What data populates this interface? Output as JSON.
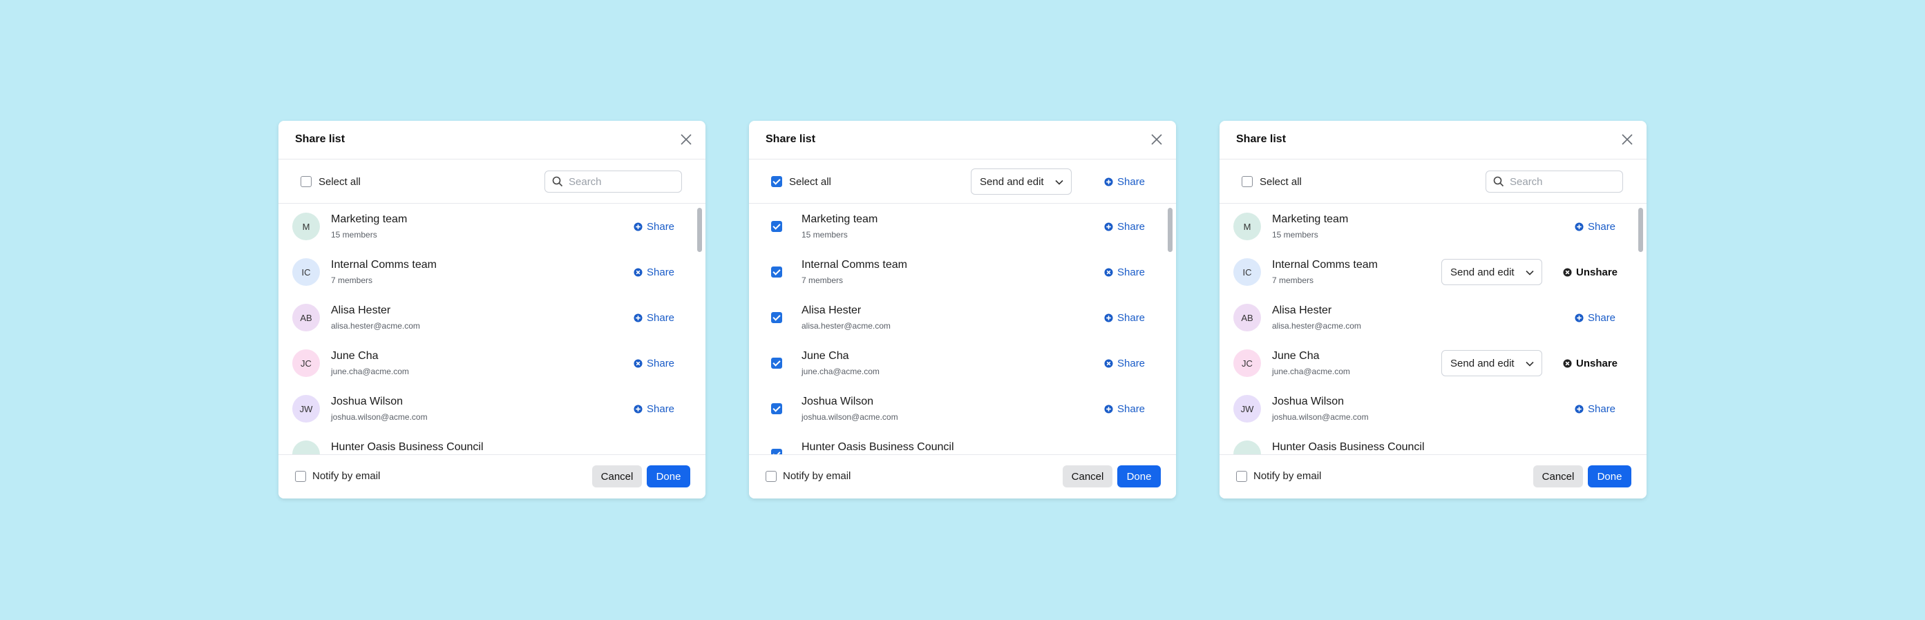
{
  "colors": {
    "background": "#bdebf6",
    "primary": "#1466ec",
    "share_link": "#1a5cc8",
    "avatar_m": "#d7ece6",
    "avatar_ic": "#dce9fb",
    "avatar_ab": "#eedcf4",
    "avatar_jc": "#fbdcef",
    "avatar_jw": "#e7defa"
  },
  "icons": {
    "close": "close-icon",
    "search": "search-icon",
    "share_plus": "plus-circle-icon",
    "share_x": "x-circle-icon",
    "chevron": "chevron-down-icon"
  },
  "common": {
    "title": "Share list",
    "select_all": "Select all",
    "search_placeholder": "Search",
    "share": "Share",
    "unshare": "Unshare",
    "permission": "Send and edit",
    "notify": "Notify by email",
    "cancel": "Cancel",
    "done": "Done",
    "partial_row": "Hunter Oasis Business Council"
  },
  "items": [
    {
      "initials": "M",
      "name": "Marketing team",
      "detail": "15 members"
    },
    {
      "initials": "IC",
      "name": "Internal Comms team",
      "detail": "7 members"
    },
    {
      "initials": "AB",
      "name": "Alisa Hester",
      "detail": "alisa.hester@acme.com"
    },
    {
      "initials": "JC",
      "name": "June Cha",
      "detail": "june.cha@acme.com"
    },
    {
      "initials": "JW",
      "name": "Joshua Wilson",
      "detail": "joshua.wilson@acme.com"
    }
  ],
  "dialogs": [
    {
      "variant": "default",
      "select_all_checked": false,
      "row_share_icons": [
        "plus",
        "x",
        "plus",
        "x",
        "plus"
      ]
    },
    {
      "variant": "bulk",
      "select_all_checked": true,
      "row_share_icons": [
        "plus",
        "x",
        "plus",
        "x",
        "plus"
      ]
    },
    {
      "variant": "per-row",
      "select_all_checked": false,
      "row_states": [
        "share",
        "unshare",
        "share",
        "unshare",
        "share"
      ]
    }
  ]
}
